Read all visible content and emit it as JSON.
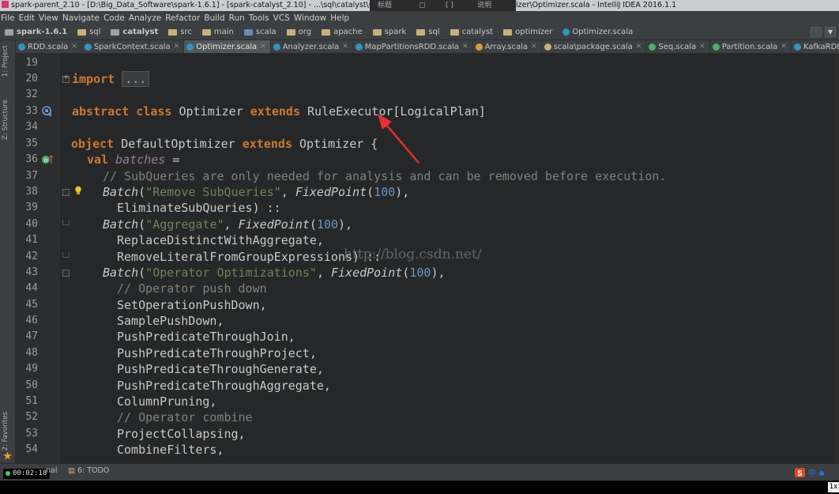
{
  "window": {
    "title": "spark-parent_2.10 - [D:\\Big_Data_Software\\spark-1.6.1] - [spark-catalyst_2.10] - ...\\sql\\catalyst\\src\\main\\scala\\org",
    "title_tail": "izer\\Optimizer.scala - IntelliJ IDEA 2016.1.1"
  },
  "menu": [
    "File",
    "Edit",
    "View",
    "Navigate",
    "Code",
    "Analyze",
    "Refactor",
    "Build",
    "Run",
    "Tools",
    "VCS",
    "Window",
    "Help"
  ],
  "breadcrumb": [
    "spark-1.6.1",
    "sql",
    "catalyst",
    "src",
    "main",
    "scala",
    "org",
    "apache",
    "spark",
    "sql",
    "catalyst",
    "optimizer",
    "Optimizer.scala"
  ],
  "tabs": [
    {
      "label": "RDD.scala",
      "color": "#3592c4",
      "active": false
    },
    {
      "label": "SparkContext.scala",
      "color": "#3592c4",
      "active": false
    },
    {
      "label": "Optimizer.scala",
      "color": "#3592c4",
      "active": true
    },
    {
      "label": "Analyzer.scala",
      "color": "#3592c4",
      "active": false
    },
    {
      "label": "MapPartitionsRDD.scala",
      "color": "#3592c4",
      "active": false
    },
    {
      "label": "Array.scala",
      "color": "#d6a03b",
      "active": false
    },
    {
      "label": "scala\\package.scala",
      "color": "#c8b07a",
      "active": false
    },
    {
      "label": "Seq.scala",
      "color": "#4fae6d",
      "active": false
    },
    {
      "label": "Partition.scala",
      "color": "#4fae6d",
      "active": false
    },
    {
      "label": "KafkaRDDPartition.scala",
      "color": "#3592c4",
      "active": false
    }
  ],
  "tools": {
    "project": "1: Project",
    "structure": "Z: Structure",
    "favorites": "2: Favorites",
    "terminal_fragment": "nal",
    "todo": "6: TODO"
  },
  "editor": {
    "line_numbers": [
      "19",
      "20",
      "32",
      "33",
      "34",
      "35",
      "36",
      "37",
      "38",
      "39",
      "40",
      "41",
      "42",
      "43",
      "44",
      "45",
      "46",
      "47",
      "48",
      "49",
      "50",
      "51",
      "52",
      "53",
      "54"
    ],
    "code": {
      "l20_kw": "import",
      "l20_fold": "...",
      "l33_kw1": "abstract class",
      "l33_name": " Optimizer ",
      "l33_kw2": "extends",
      "l33_rest": " RuleExecutor[LogicalPlan]",
      "l35_kw1": "object",
      "l35_name": " DefaultOptimizer ",
      "l35_kw2": "extends",
      "l35_rest": " Optimizer {",
      "l36_kw": "val",
      "l36_var": "batches",
      "l36_rest": " =",
      "l37": "// SubQueries are only needed for analysis and can be removed before execution.",
      "l38_fn": "Batch",
      "l38_str": "\"Remove SubQueries\"",
      "l38_fp": "FixedPoint",
      "l38_num": "100",
      "l39": "EliminateSubQueries) ::",
      "l40_fn": "Batch",
      "l40_str": "\"Aggregate\"",
      "l40_fp": "FixedPoint",
      "l40_num": "100",
      "l41": "ReplaceDistinctWithAggregate,",
      "l42": "RemoveLiteralFromGroupExpressions) ::",
      "l43_fn": "Batch",
      "l43_str": "\"Operator Optimizations\"",
      "l43_fp": "FixedPoint",
      "l43_num": "100",
      "l44": "// Operator push down",
      "l45": "SetOperationPushDown,",
      "l46": "SamplePushDown,",
      "l47": "PushPredicateThroughJoin,",
      "l48": "PushPredicateThroughProject,",
      "l49": "PushPredicateThroughGenerate,",
      "l50": "PushPredicateThroughAggregate,",
      "l51": "ColumnPruning,",
      "l52": "// Operator combine",
      "l53": "ProjectCollapsing,",
      "l54": "CombineFilters,"
    },
    "watermark": "http://blog.csdn.net/"
  },
  "status": {
    "timer": "00:02:18",
    "corner": "1x"
  },
  "colors": {
    "keyword": "#cc7832",
    "string": "#6a8759",
    "number": "#6897bb",
    "comment": "#808080",
    "annotation_arrow": "#e8322e"
  }
}
